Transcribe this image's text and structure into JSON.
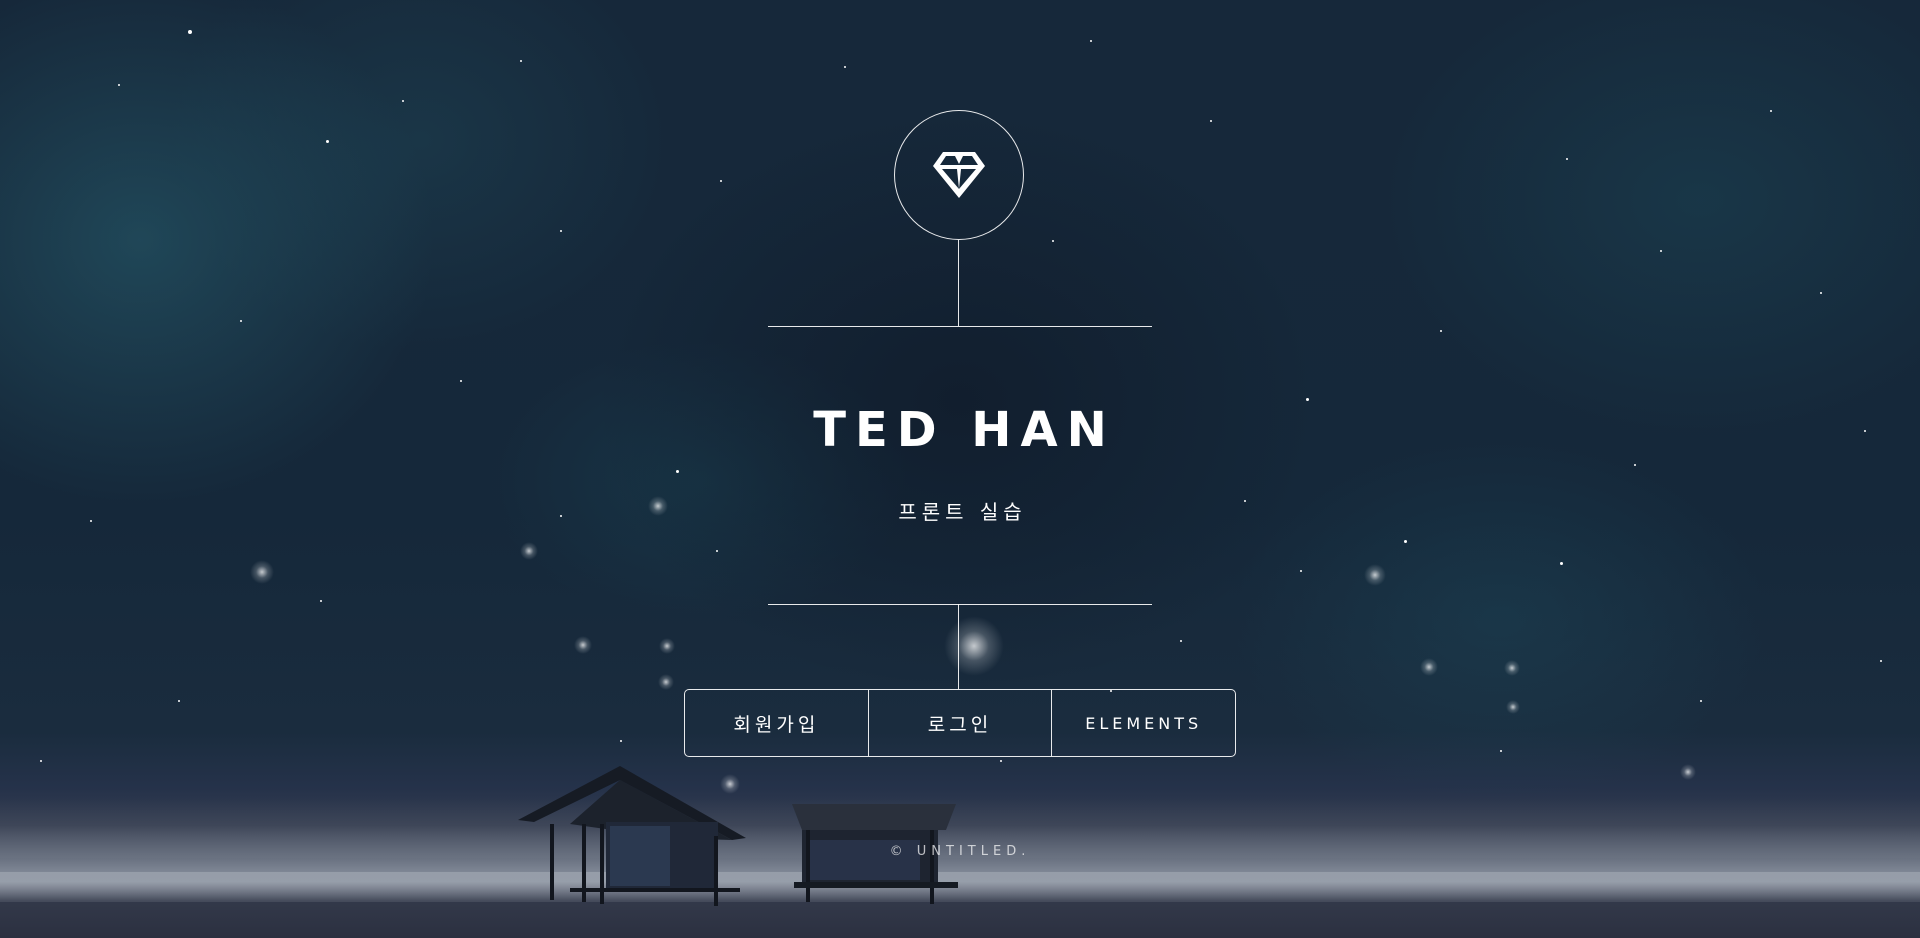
{
  "header": {
    "logo_icon": "diamond-icon",
    "title": "TED HAN",
    "subtitle": "프론트 실습"
  },
  "nav": {
    "items": [
      {
        "label": "회원가입"
      },
      {
        "label": "로그인"
      },
      {
        "label": "ELEMENTS"
      }
    ]
  },
  "footer": {
    "text": "© UNTITLED."
  },
  "colors": {
    "sky": "#15283a",
    "line": "#ffffff"
  }
}
